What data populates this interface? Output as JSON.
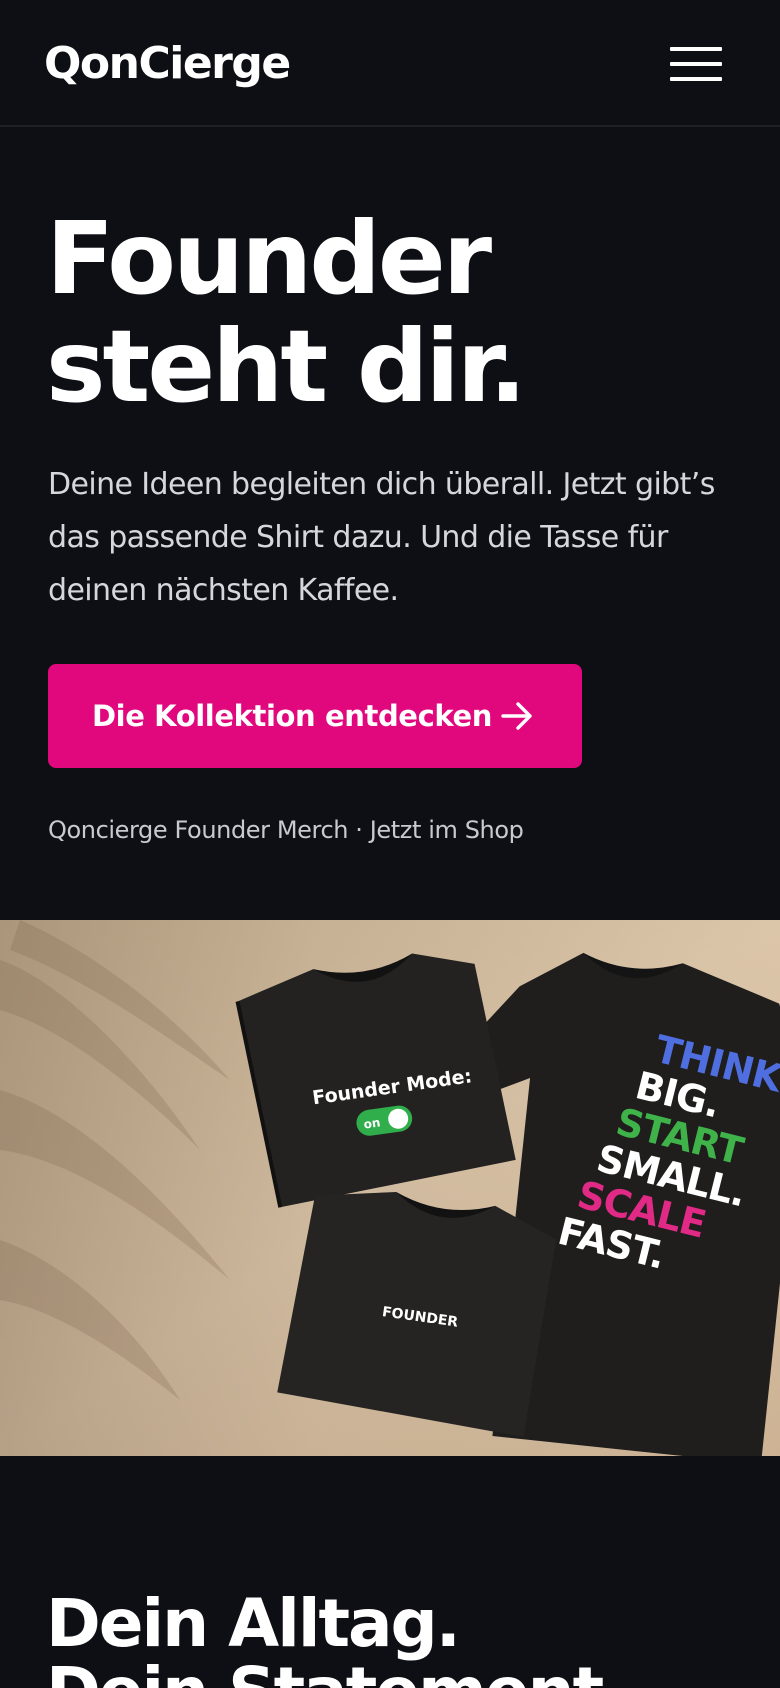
{
  "header": {
    "logo_text": "QonCierge",
    "menu_icon": "hamburger-menu-icon"
  },
  "hero": {
    "title_line1": "Founder",
    "title_line2": "steht dir.",
    "text": "Deine Ideen begleiten dich überall. Jetzt gibt’s das passende Shirt dazu. Und die Tasse für deinen nächsten Kaffee.",
    "cta_label": "Die Kollektion entdecken",
    "cta_icon": "arrow-right-icon",
    "subline": "Qoncierge Founder Merch · Jetzt im Shop"
  },
  "product_image": {
    "shirt1_line1": "Founder Mode:",
    "shirt1_toggle": "on",
    "shirt2_text": "FOUNDER",
    "shirt3_line1": "THINK",
    "shirt3_line2": "BIG.",
    "shirt3_line3": "START",
    "shirt3_line4": "SMALL.",
    "shirt3_line5": "SCALE",
    "shirt3_line6": "FAST."
  },
  "section2": {
    "title_line1": "Dein Alltag.",
    "title_line2": "Dein Statement."
  },
  "colors": {
    "background": "#0e0f14",
    "accent": "#e1087e",
    "text_muted": "#d6d7dc"
  }
}
